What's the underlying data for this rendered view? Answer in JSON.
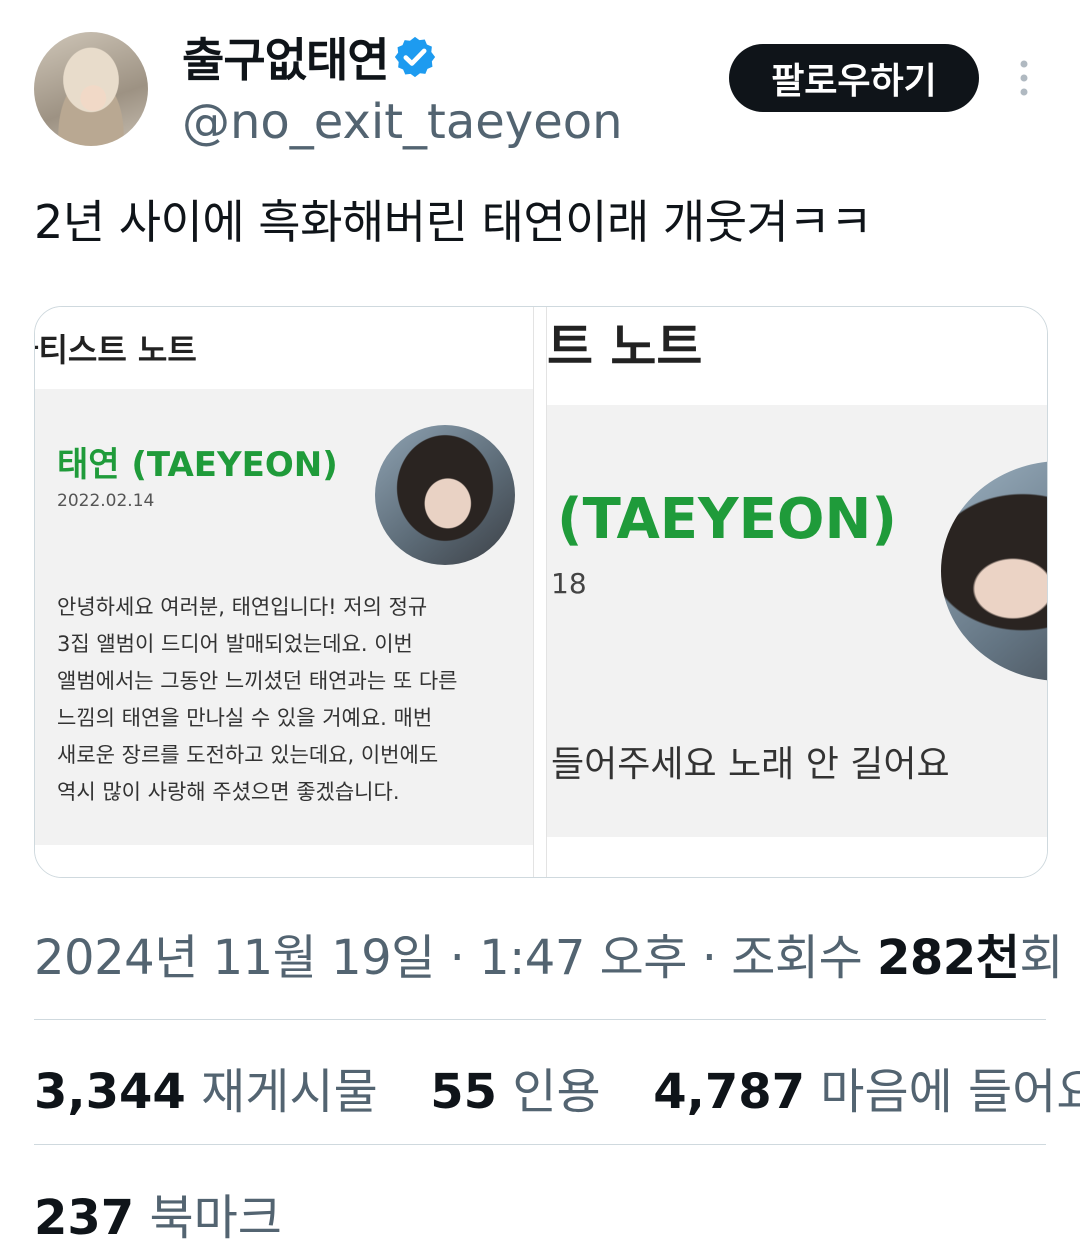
{
  "author": {
    "display_name": "출구없태연",
    "handle": "@no_exit_taeyeon",
    "verified_badge_color": "#1d9bf0"
  },
  "follow_button_label": "팔로우하기",
  "tweet_text": "2년 사이에 흑화해버린 태연이래 개웃겨ㅋㅋ",
  "media": {
    "left": {
      "header": "아티스트 노트",
      "title": "태연 (TAEYEON)",
      "date": "2022.02.14",
      "body_lines": [
        "안녕하세요 여러분, 태연입니다! 저의 정규",
        "3집 앨범이 드디어 발매되었는데요. 이번",
        "앨범에서는 그동안 느끼셨던 태연과는 또 다른",
        "느낌의 태연을 만나실 수 있을 거예요. 매번",
        "새로운 장르를 도전하고 있는데요, 이번에도",
        "역시 많이 사랑해 주셨으면 좋겠습니다."
      ]
    },
    "right": {
      "header": "트 노트",
      "title": "(TAEYEON)",
      "date": "18",
      "body": "들어주세요 노래 안 길어요"
    },
    "accent_green": "#1f9b3a"
  },
  "meta": {
    "date": "2024년 11월 19일",
    "time": "1:47 오후",
    "views_label": "조회수",
    "views_value": "282천",
    "views_suffix": "회"
  },
  "stats": {
    "reposts": "3,344",
    "reposts_label": "재게시물",
    "quotes": "55",
    "quotes_label": "인용",
    "likes": "4,787",
    "likes_label": "마음에 들어요",
    "bookmarks": "237",
    "bookmarks_label": "북마크"
  }
}
